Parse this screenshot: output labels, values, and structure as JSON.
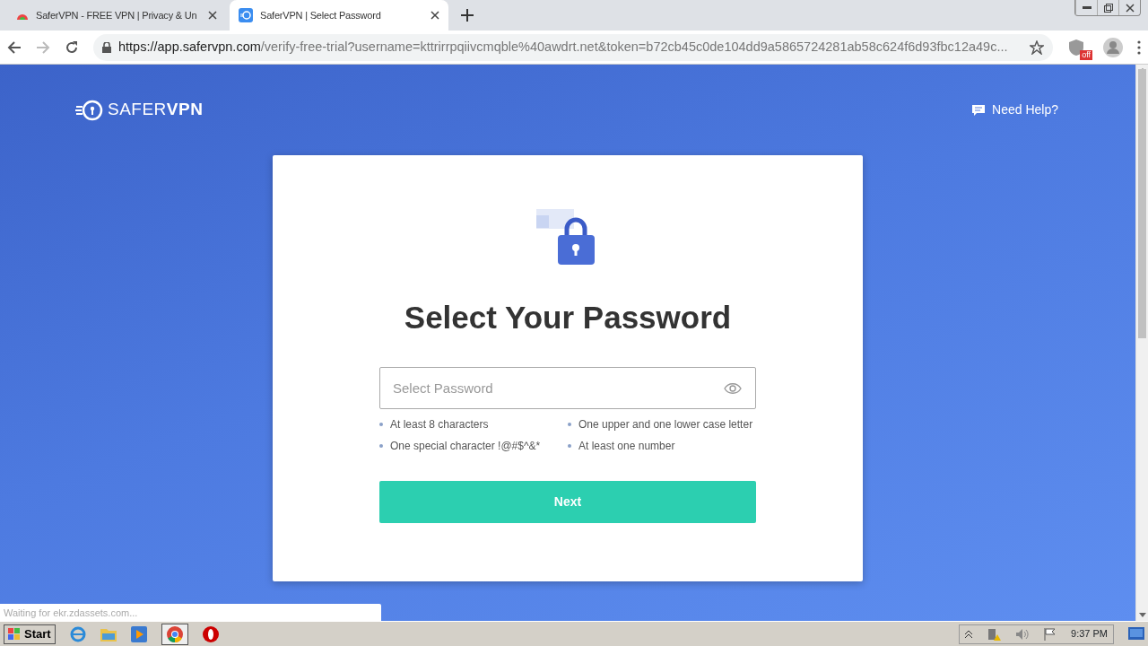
{
  "browser": {
    "tabs": [
      {
        "title": "SaferVPN - FREE VPN | Privacy & Un",
        "selected": false
      },
      {
        "title": "SaferVPN | Select Password",
        "selected": true
      }
    ],
    "url": {
      "host": "https://app.safervpn.com",
      "path": "/verify-free-trial?username=kttrirrpqiivcmqble%40awdrt.net&token=b72cb45c0de104dd9a5865724281ab58c624f6d93fbc12a49c..."
    },
    "extension_badge": "off"
  },
  "page": {
    "logo": "SAFER**VPN**",
    "help_link": "Need Help?",
    "title": "Select Your Password",
    "password_field": {
      "placeholder": "Select Password"
    },
    "requirements": [
      "At least 8 characters",
      "One upper and one lower case letter",
      "One special character !@#$^&*",
      "At least one number"
    ],
    "next_button": "Next"
  },
  "status_text": "Waiting for ekr.zdassets.com...",
  "taskbar": {
    "start": "Start",
    "clock": "9:37 PM"
  }
}
